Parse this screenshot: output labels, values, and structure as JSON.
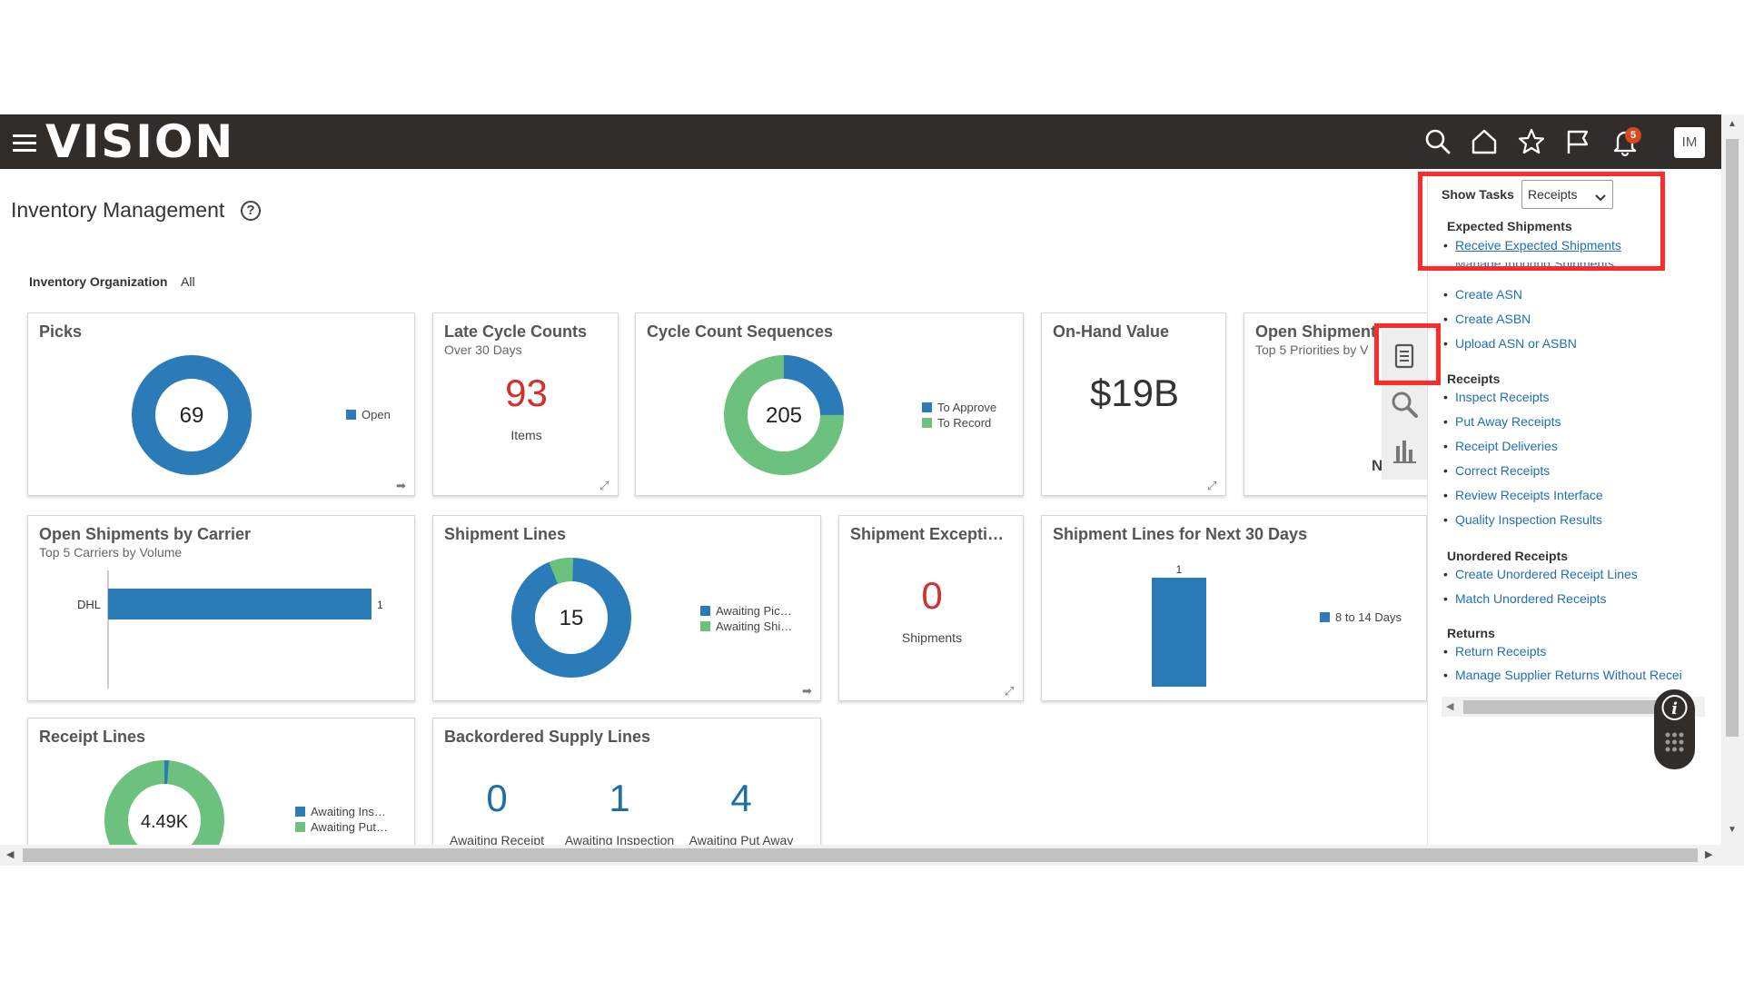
{
  "header": {
    "logo": "VISION",
    "notification_count": "5",
    "user_initials": "IM"
  },
  "page": {
    "title": "Inventory Management",
    "org_label": "Inventory Organization",
    "org_value": "All"
  },
  "colors": {
    "blue": "#2b7bb9",
    "green": "#6cc17e",
    "red": "#d32f2f",
    "link": "#1f6fb5",
    "highlight": "#ff2b2b"
  },
  "tiles": {
    "picks": {
      "title": "Picks",
      "center": "69",
      "legend": [
        "Open"
      ],
      "chart_data": {
        "type": "pie",
        "values": [
          69
        ],
        "labels": [
          "Open"
        ]
      }
    },
    "late_cycle": {
      "title": "Late Cycle Counts",
      "subtitle": "Over 30 Days",
      "value": "93",
      "unit": "Items"
    },
    "cycle_seq": {
      "title": "Cycle Count Sequences",
      "center": "205",
      "legend": [
        "To Approve",
        "To Record"
      ],
      "chart_data": {
        "type": "pie",
        "values": [
          15,
          85
        ],
        "labels": [
          "To Approve",
          "To Record"
        ]
      }
    },
    "onhand": {
      "title": "On-Hand Value",
      "value": "$19B"
    },
    "open_ship": {
      "title": "Open Shipment",
      "subtitle": "Top 5 Priorities by V",
      "fragment": "N"
    },
    "carrier": {
      "title": "Open Shipments by Carrier",
      "subtitle": "Top 5 Carriers by Volume",
      "chart_data": {
        "type": "bar",
        "categories": [
          "DHL"
        ],
        "values": [
          1
        ]
      }
    },
    "ship_lines": {
      "title": "Shipment Lines",
      "center": "15",
      "legend": [
        "Awaiting Pic…",
        "Awaiting Shi…"
      ],
      "chart_data": {
        "type": "pie",
        "values": [
          14,
          1
        ],
        "labels": [
          "Awaiting Pic…",
          "Awaiting Shi…"
        ]
      }
    },
    "ship_except": {
      "title": "Shipment Excepti…",
      "value": "0",
      "unit": "Shipments"
    },
    "next30": {
      "title": "Shipment Lines for Next 30 Days",
      "legend": [
        "8 to 14 Days"
      ],
      "chart_data": {
        "type": "bar",
        "categories": [
          "8 to 14 Days"
        ],
        "values": [
          1
        ]
      }
    },
    "receipt_lines": {
      "title": "Receipt Lines",
      "center": "4.49K",
      "legend": [
        "Awaiting Ins…",
        "Awaiting Put…"
      ],
      "chart_data": {
        "type": "pie",
        "values": [
          1,
          99
        ],
        "labels": [
          "Awaiting Ins…",
          "Awaiting Put…"
        ]
      }
    },
    "backorder": {
      "title": "Backordered Supply Lines",
      "items": [
        {
          "value": "0",
          "label": "Awaiting Receipt"
        },
        {
          "value": "1",
          "label": "Awaiting Inspection"
        },
        {
          "value": "4",
          "label": "Awaiting Put Away"
        }
      ]
    }
  },
  "tasks": {
    "label": "Show Tasks",
    "selected": "Receipts",
    "groups": [
      {
        "name": "Expected Shipments",
        "links": [
          "Receive Expected Shipments",
          "Manage Inbound Shipments",
          "Create ASN",
          "Create ASBN",
          "Upload ASN or ASBN"
        ]
      },
      {
        "name": "Receipts",
        "links": [
          "Inspect Receipts",
          "Put Away Receipts",
          "Receipt Deliveries",
          "Correct Receipts",
          "Review Receipts Interface",
          "Quality Inspection Results"
        ]
      },
      {
        "name": "Unordered Receipts",
        "links": [
          "Create Unordered Receipt Lines",
          "Match Unordered Receipts"
        ]
      },
      {
        "name": "Returns",
        "links": [
          "Return Receipts",
          "Manage Supplier Returns Without Recei"
        ]
      }
    ]
  },
  "icons": [
    "hamburger-icon",
    "search-icon",
    "home-icon",
    "star-icon",
    "flag-icon",
    "bell-icon",
    "help-icon",
    "tasks-list-icon",
    "magnifier-icon",
    "bar-chart-icon",
    "info-icon",
    "expand-icon",
    "arrow-icon"
  ]
}
